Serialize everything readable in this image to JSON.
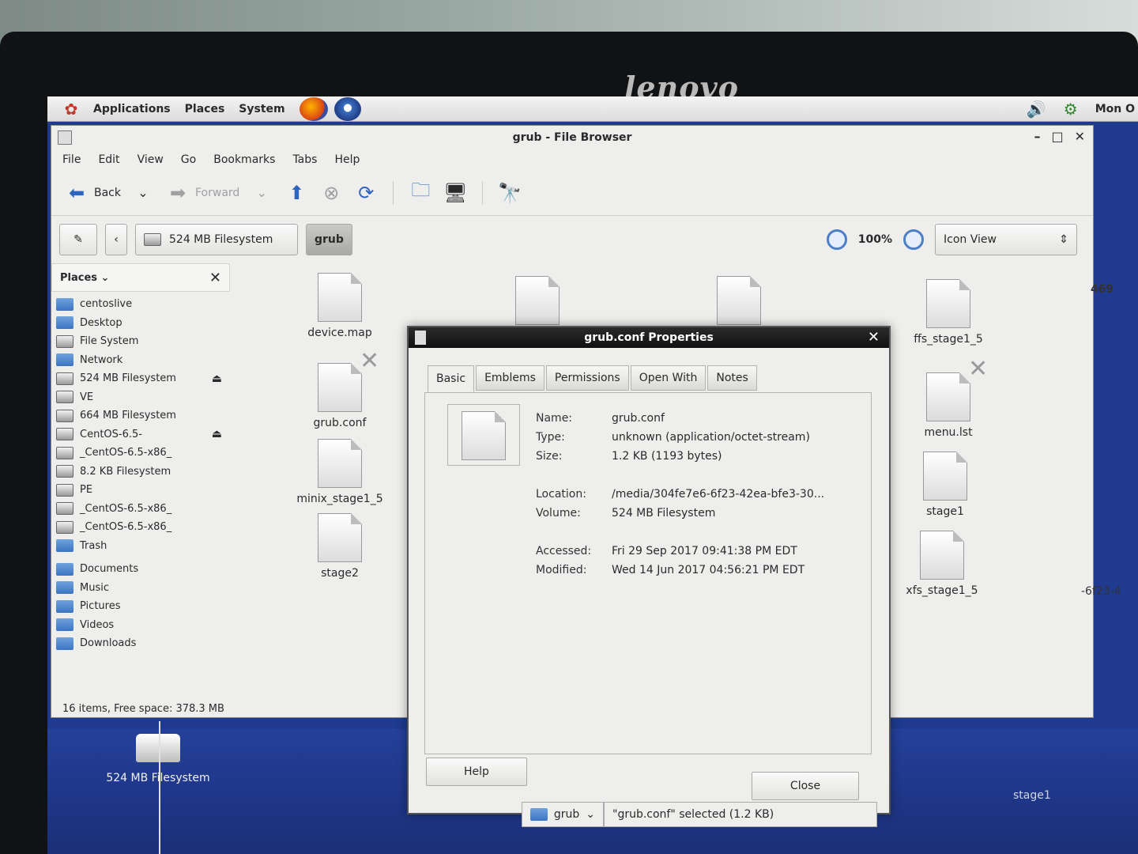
{
  "monitor": {
    "brand": "lenovo"
  },
  "top_panel": {
    "menus": [
      "Applications",
      "Places",
      "System"
    ],
    "clock": "Mon O",
    "launchers": [
      "firefox-icon",
      "thunderbird-icon"
    ]
  },
  "file_browser": {
    "title": "grub - File Browser",
    "menubar": [
      "File",
      "Edit",
      "View",
      "Go",
      "Bookmarks",
      "Tabs",
      "Help"
    ],
    "toolbar": {
      "back": "Back",
      "forward": "Forward"
    },
    "location": {
      "parent": "524 MB Filesystem",
      "current": "grub"
    },
    "zoom": "100%",
    "view_mode": "Icon View",
    "sidebar": {
      "header": "Places",
      "items": [
        {
          "label": "centoslive",
          "icon": "home"
        },
        {
          "label": "Desktop",
          "icon": "folder"
        },
        {
          "label": "File System",
          "icon": "drive"
        },
        {
          "label": "Network",
          "icon": "network"
        },
        {
          "label": "524 MB Filesystem",
          "icon": "drive",
          "eject": "⏏"
        },
        {
          "label": "VE",
          "icon": "drive"
        },
        {
          "label": "664 MB Filesystem",
          "icon": "drive"
        },
        {
          "label": "CentOS-6.5-",
          "icon": "disc",
          "eject": "⏏"
        },
        {
          "label": "_CentOS-6.5-x86_",
          "icon": "drive"
        },
        {
          "label": "8.2 KB Filesystem",
          "icon": "drive"
        },
        {
          "label": "PE",
          "icon": "drive"
        },
        {
          "label": "_CentOS-6.5-x86_",
          "icon": "drive"
        },
        {
          "label": "_CentOS-6.5-x86_",
          "icon": "drive"
        },
        {
          "label": "Trash",
          "icon": "trash"
        }
      ],
      "bookmarks": [
        "Documents",
        "Music",
        "Pictures",
        "Videos",
        "Downloads"
      ]
    },
    "status": "16 items, Free space: 378.3 MB",
    "files": [
      "device.map",
      "grub.conf",
      "minix_stage1_5",
      "stage2",
      "ffs_stage1_5",
      "menu.lst",
      "stage1",
      "xfs_stage1_5"
    ],
    "right_edge_text": [
      "469",
      "-6f23-4"
    ]
  },
  "properties_dialog": {
    "title": "grub.conf Properties",
    "tabs": [
      "Basic",
      "Emblems",
      "Permissions",
      "Open With",
      "Notes"
    ],
    "fields": {
      "name_label": "Name:",
      "name": "grub.conf",
      "type_label": "Type:",
      "type": "unknown (application/octet-stream)",
      "size_label": "Size:",
      "size": "1.2 KB (1193 bytes)",
      "location_label": "Location:",
      "location": "/media/304fe7e6-6f23-42ea-bfe3-30...",
      "volume_label": "Volume:",
      "volume": "524 MB Filesystem",
      "accessed_label": "Accessed:",
      "accessed": "Fri 29 Sep 2017 09:41:38 PM EDT",
      "modified_label": "Modified:",
      "modified": "Wed 14 Jun 2017 04:56:21 PM EDT"
    },
    "help": "Help",
    "close": "Close"
  },
  "desktop": {
    "icon_label": "524 MB Filesystem",
    "taskbar_folder": "grub",
    "taskbar_status": "\"grub.conf\" selected (1.2 KB)",
    "behind_text": "stage1"
  }
}
